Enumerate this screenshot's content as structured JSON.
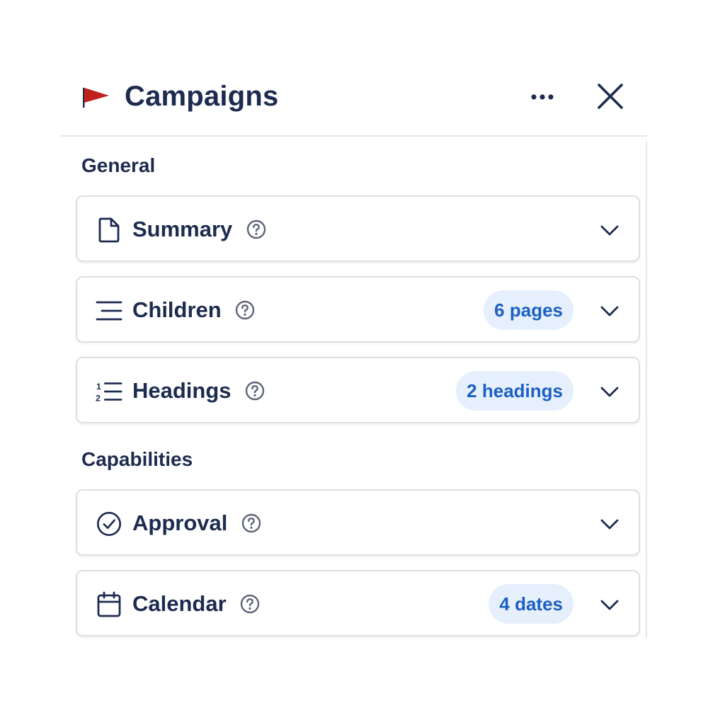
{
  "header": {
    "title": "Campaigns",
    "flag_color": "#c0201c",
    "icons": {
      "flag": "flag-icon",
      "more": "more-horizontal-icon",
      "close": "close-icon"
    }
  },
  "sections": [
    {
      "title": "General",
      "cards": [
        {
          "label": "Summary",
          "icon": "file-icon",
          "badge": ""
        },
        {
          "label": "Children",
          "icon": "lines-icon",
          "badge": "6 pages"
        },
        {
          "label": "Headings",
          "icon": "numbered-list-icon",
          "badge": "2 headings"
        }
      ]
    },
    {
      "title": "Capabilities",
      "cards": [
        {
          "label": "Approval",
          "icon": "check-circle-icon",
          "badge": ""
        },
        {
          "label": "Calendar",
          "icon": "calendar-icon",
          "badge": "4 dates"
        }
      ]
    }
  ],
  "colors": {
    "text": "#1d2b4f",
    "badge_bg": "#e5f0fc",
    "badge_text": "#1d5fc2",
    "border": "#dcdfe4"
  }
}
